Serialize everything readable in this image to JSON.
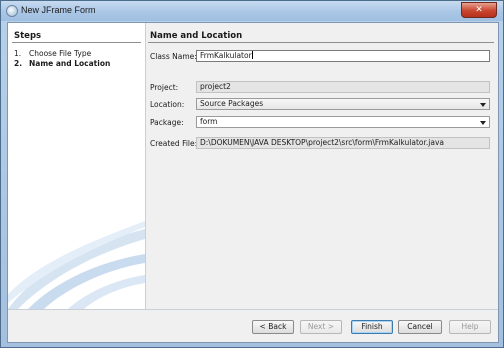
{
  "window": {
    "title": "New JFrame Form",
    "close_glyph": "✕"
  },
  "steps": {
    "heading": "Steps",
    "items": [
      {
        "num": "1.",
        "label": "Choose File Type"
      },
      {
        "num": "2.",
        "label": "Name and Location"
      }
    ]
  },
  "main": {
    "heading": "Name and Location",
    "class_name": {
      "label": "Class Name:",
      "value": "FrmKalkulator"
    },
    "project": {
      "label": "Project:",
      "value": "project2"
    },
    "location": {
      "label": "Location:",
      "value": "Source Packages"
    },
    "package": {
      "label": "Package:",
      "value": "form"
    },
    "created_file": {
      "label": "Created File:",
      "value": "D:\\DOKUMEN\\JAVA DESKTOP\\project2\\src\\form\\FrmKalkulator.java"
    }
  },
  "buttons": {
    "back": "< Back",
    "next": "Next >",
    "finish": "Finish",
    "cancel": "Cancel",
    "help": "Help"
  }
}
